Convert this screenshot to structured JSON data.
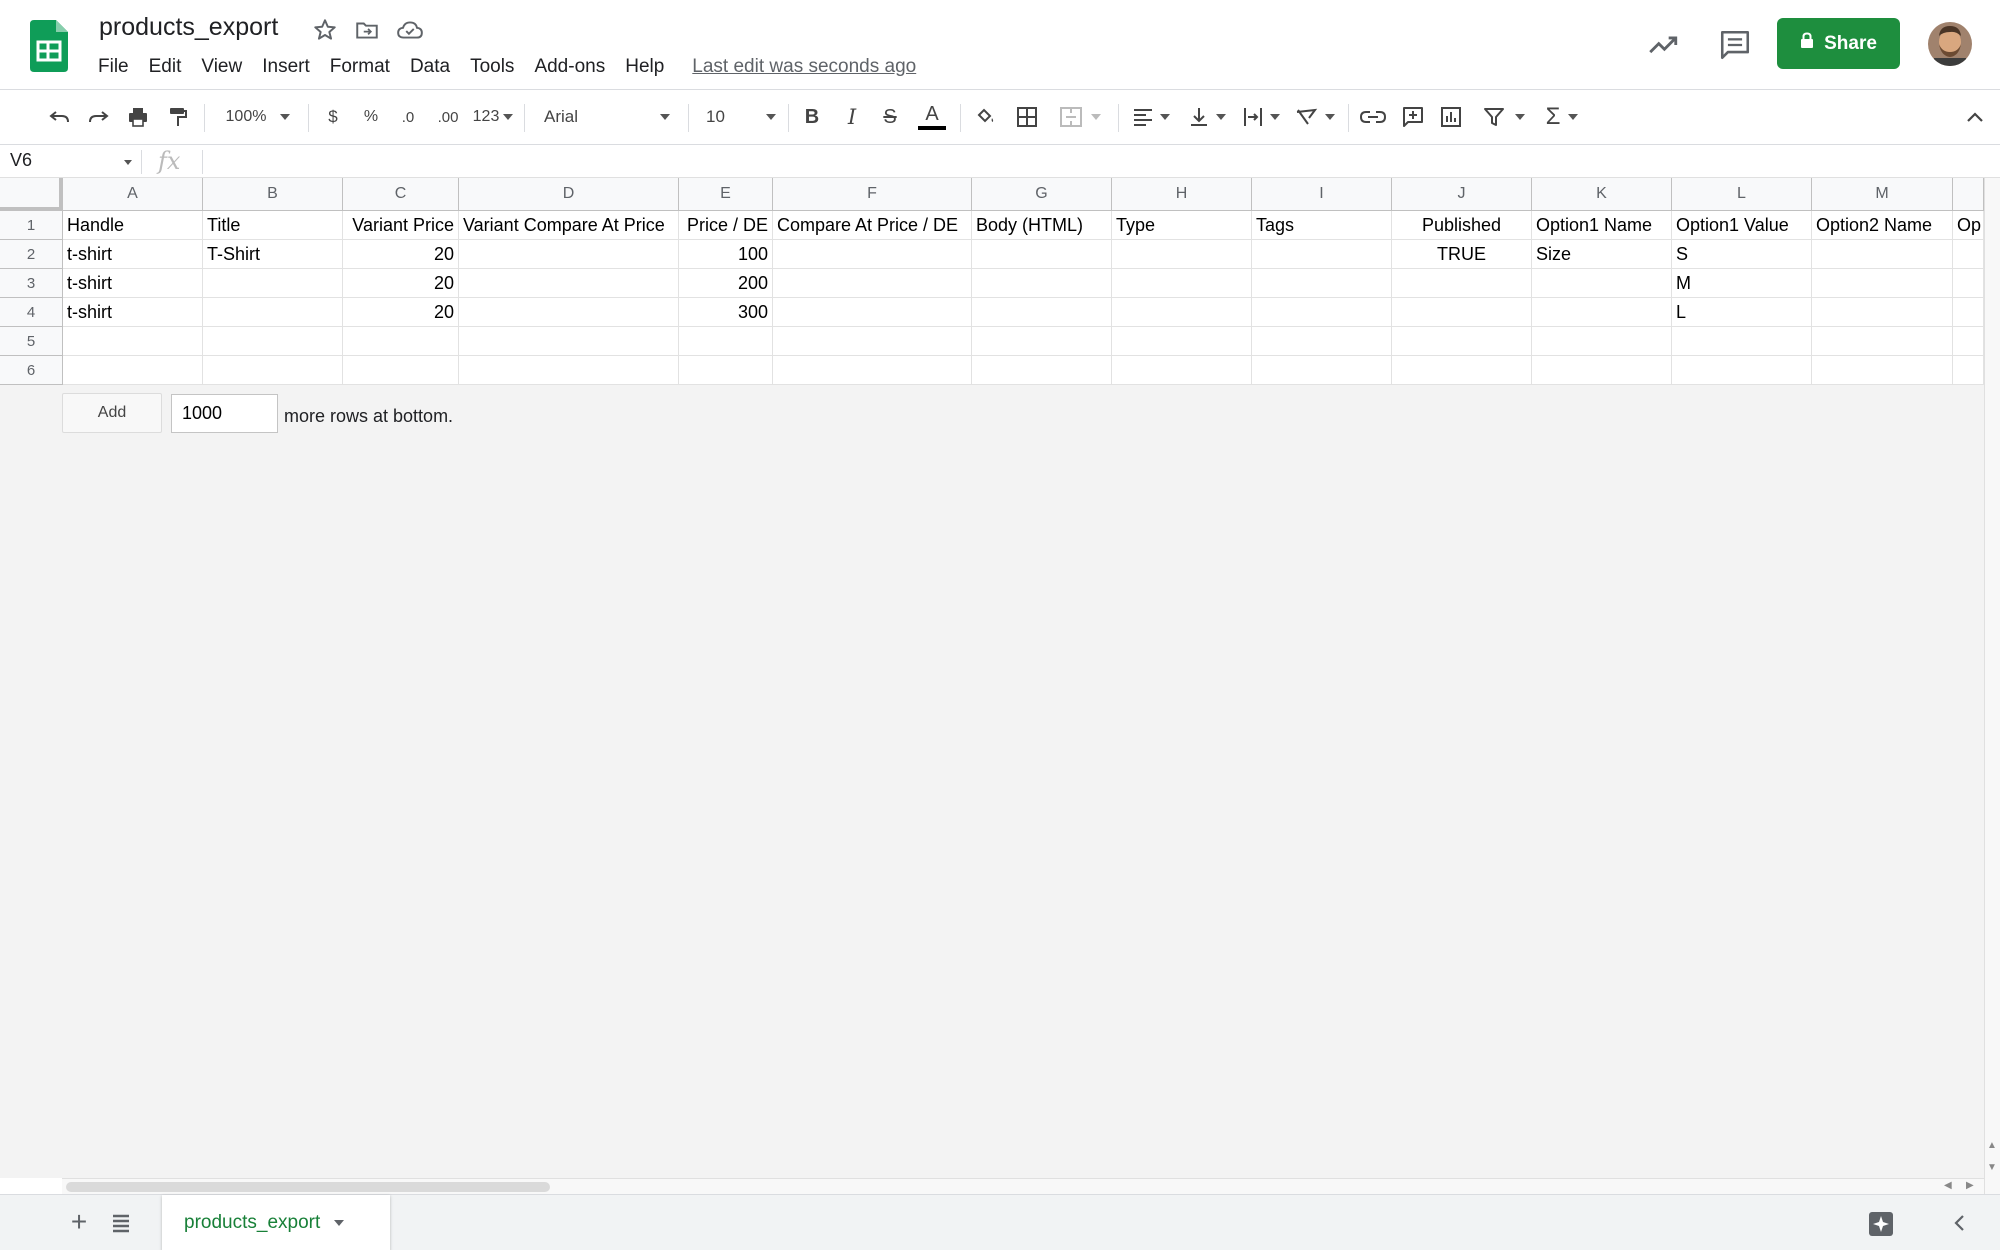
{
  "document": {
    "title": "products_export",
    "last_edit": "Last edit was seconds ago"
  },
  "menu": [
    "File",
    "Edit",
    "View",
    "Insert",
    "Format",
    "Data",
    "Tools",
    "Add-ons",
    "Help"
  ],
  "share_label": "Share",
  "toolbar": {
    "zoom": "100%",
    "currency": "$",
    "percent": "%",
    "decrease_decimal": ".0",
    "increase_decimal": ".00",
    "more_formats": "123",
    "font": "Arial",
    "font_size": "10"
  },
  "formula_bar": {
    "cell_ref": "V6",
    "fx": "fx",
    "value": ""
  },
  "columns": [
    "A",
    "B",
    "C",
    "D",
    "E",
    "F",
    "G",
    "H",
    "I",
    "J",
    "K",
    "L",
    "M"
  ],
  "row_numbers": [
    "1",
    "2",
    "3",
    "4",
    "5",
    "6"
  ],
  "rows": [
    [
      "Handle",
      "Title",
      "Variant Price",
      "Variant Compare At Price",
      "Price / DE",
      "Compare At Price / DE",
      "Body (HTML)",
      "Type",
      "Tags",
      "Published",
      "Option1 Name",
      "Option1 Value",
      "Option2 Name",
      "Op"
    ],
    [
      "t-shirt",
      "T-Shirt",
      "20",
      "",
      "100",
      "",
      "",
      "",
      "",
      "TRUE",
      "Size",
      "S",
      "",
      ""
    ],
    [
      "t-shirt",
      "",
      "20",
      "",
      "200",
      "",
      "",
      "",
      "",
      "",
      "",
      "M",
      "",
      ""
    ],
    [
      "t-shirt",
      "",
      "20",
      "",
      "300",
      "",
      "",
      "",
      "",
      "",
      "",
      "L",
      "",
      ""
    ],
    [
      "",
      "",
      "",
      "",
      "",
      "",
      "",
      "",
      "",
      "",
      "",
      "",
      "",
      ""
    ],
    [
      "",
      "",
      "",
      "",
      "",
      "",
      "",
      "",
      "",
      "",
      "",
      "",
      "",
      ""
    ]
  ],
  "add_rows": {
    "button": "Add",
    "count": "1000",
    "suffix": "more rows at bottom."
  },
  "sheet_tabs": [
    {
      "label": "products_export",
      "active": true
    }
  ],
  "colors": {
    "accent_green": "#1e8e3e",
    "sheet_tab_text": "#188038"
  },
  "icons": [
    "sheets-logo-icon",
    "star-icon",
    "move-folder-icon",
    "cloud-saved-icon",
    "trend-icon",
    "comment-icon",
    "lock-icon"
  ]
}
